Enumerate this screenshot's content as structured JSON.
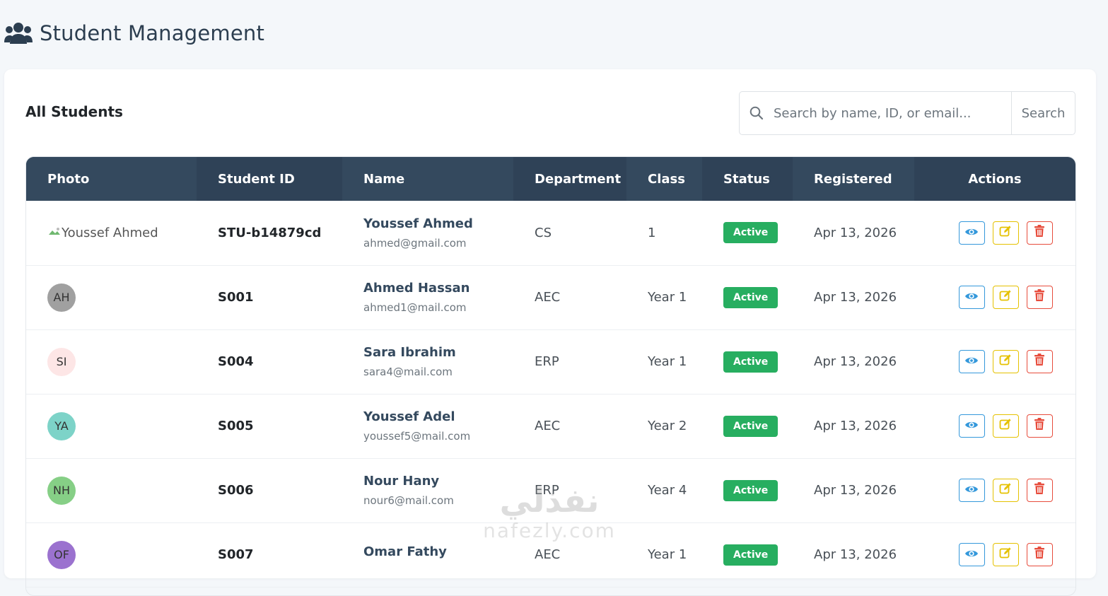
{
  "header": {
    "title": "Student Management",
    "icon": "users-icon"
  },
  "card": {
    "title": "All Students"
  },
  "search": {
    "placeholder": "Search by name, ID, or email...",
    "button_label": "Search"
  },
  "table": {
    "columns": [
      "Photo",
      "Student ID",
      "Name",
      "Department",
      "Class",
      "Status",
      "Registered",
      "Actions"
    ],
    "rows": [
      {
        "photo": {
          "type": "broken-image",
          "alt": "Youssef Ahmed"
        },
        "id": "STU-b14879cd",
        "name": "Youssef Ahmed",
        "email": "ahmed@gmail.com",
        "department": "CS",
        "class": "1",
        "status": "Active",
        "registered": "Apr 13, 2026"
      },
      {
        "photo": {
          "type": "initials",
          "initials": "AH",
          "color": "#a0a0a0"
        },
        "id": "S001",
        "name": "Ahmed Hassan",
        "email": "ahmed1@mail.com",
        "department": "AEC",
        "class": "Year 1",
        "status": "Active",
        "registered": "Apr 13, 2026"
      },
      {
        "photo": {
          "type": "initials",
          "initials": "SI",
          "color": "#fde6e6"
        },
        "id": "S004",
        "name": "Sara Ibrahim",
        "email": "sara4@mail.com",
        "department": "ERP",
        "class": "Year 1",
        "status": "Active",
        "registered": "Apr 13, 2026"
      },
      {
        "photo": {
          "type": "initials",
          "initials": "YA",
          "color": "#7dd3c8"
        },
        "id": "S005",
        "name": "Youssef Adel",
        "email": "youssef5@mail.com",
        "department": "AEC",
        "class": "Year 2",
        "status": "Active",
        "registered": "Apr 13, 2026"
      },
      {
        "photo": {
          "type": "initials",
          "initials": "NH",
          "color": "#86cf86"
        },
        "id": "S006",
        "name": "Nour Hany",
        "email": "nour6@mail.com",
        "department": "ERP",
        "class": "Year 4",
        "status": "Active",
        "registered": "Apr 13, 2026"
      },
      {
        "photo": {
          "type": "initials",
          "initials": "OF",
          "color": "#9b72cf"
        },
        "id": "S007",
        "name": "Omar Fathy",
        "email": "",
        "department": "AEC",
        "class": "Year 1",
        "status": "Active",
        "registered": "Apr 13, 2026"
      }
    ]
  },
  "actions": {
    "view_icon": "eye-icon",
    "edit_icon": "edit-icon",
    "delete_icon": "trash-icon"
  },
  "colors": {
    "header_bg": "#2f4257",
    "status_active": "#27ae60",
    "view": "#3498db",
    "edit": "#e5c100",
    "delete": "#e74c3c"
  },
  "watermark": {
    "arabic": "نفذلي",
    "latin": "nafezly.com"
  }
}
